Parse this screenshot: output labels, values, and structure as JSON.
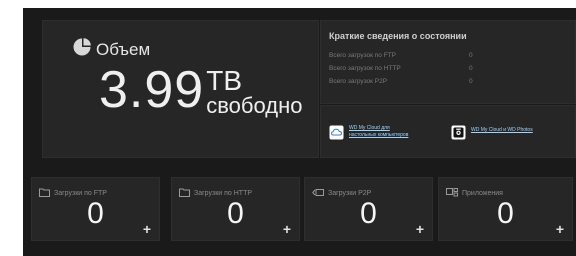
{
  "capacity": {
    "title": "Объем",
    "value": "3.99",
    "unit": "ТВ",
    "free_label": "свободно"
  },
  "status": {
    "heading": "Краткие сведения о состоянии",
    "rows": [
      {
        "label": "Всего загрузок по FTP",
        "value": "0"
      },
      {
        "label": "Всего загрузок по HTTP",
        "value": "0"
      },
      {
        "label": "Всего загрузок P2P",
        "value": "0"
      }
    ]
  },
  "apps": {
    "links": [
      {
        "line1": "WD My Cloud для",
        "line2": "настольных компьютеров",
        "icon": "desktop-app-icon"
      },
      {
        "line1": "WD My Cloud и WD Photos",
        "line2": "",
        "icon": "mobile-app-icon"
      }
    ]
  },
  "tiles": [
    {
      "label": "Загрузки по FTP",
      "value": "0",
      "icon": "folder-icon"
    },
    {
      "label": "Загрузки по HTTP",
      "value": "0",
      "icon": "folder-icon"
    },
    {
      "label": "Загрузки P2P",
      "value": "0",
      "icon": "p2p-icon"
    },
    {
      "label": "Приложения",
      "value": "0",
      "icon": "apps-icon"
    }
  ],
  "colors": {
    "background": "#1a1a1a",
    "panel": "#262626",
    "text_primary": "#efefef",
    "text_muted": "#7a7a7a",
    "link": "#9fd4ff"
  }
}
